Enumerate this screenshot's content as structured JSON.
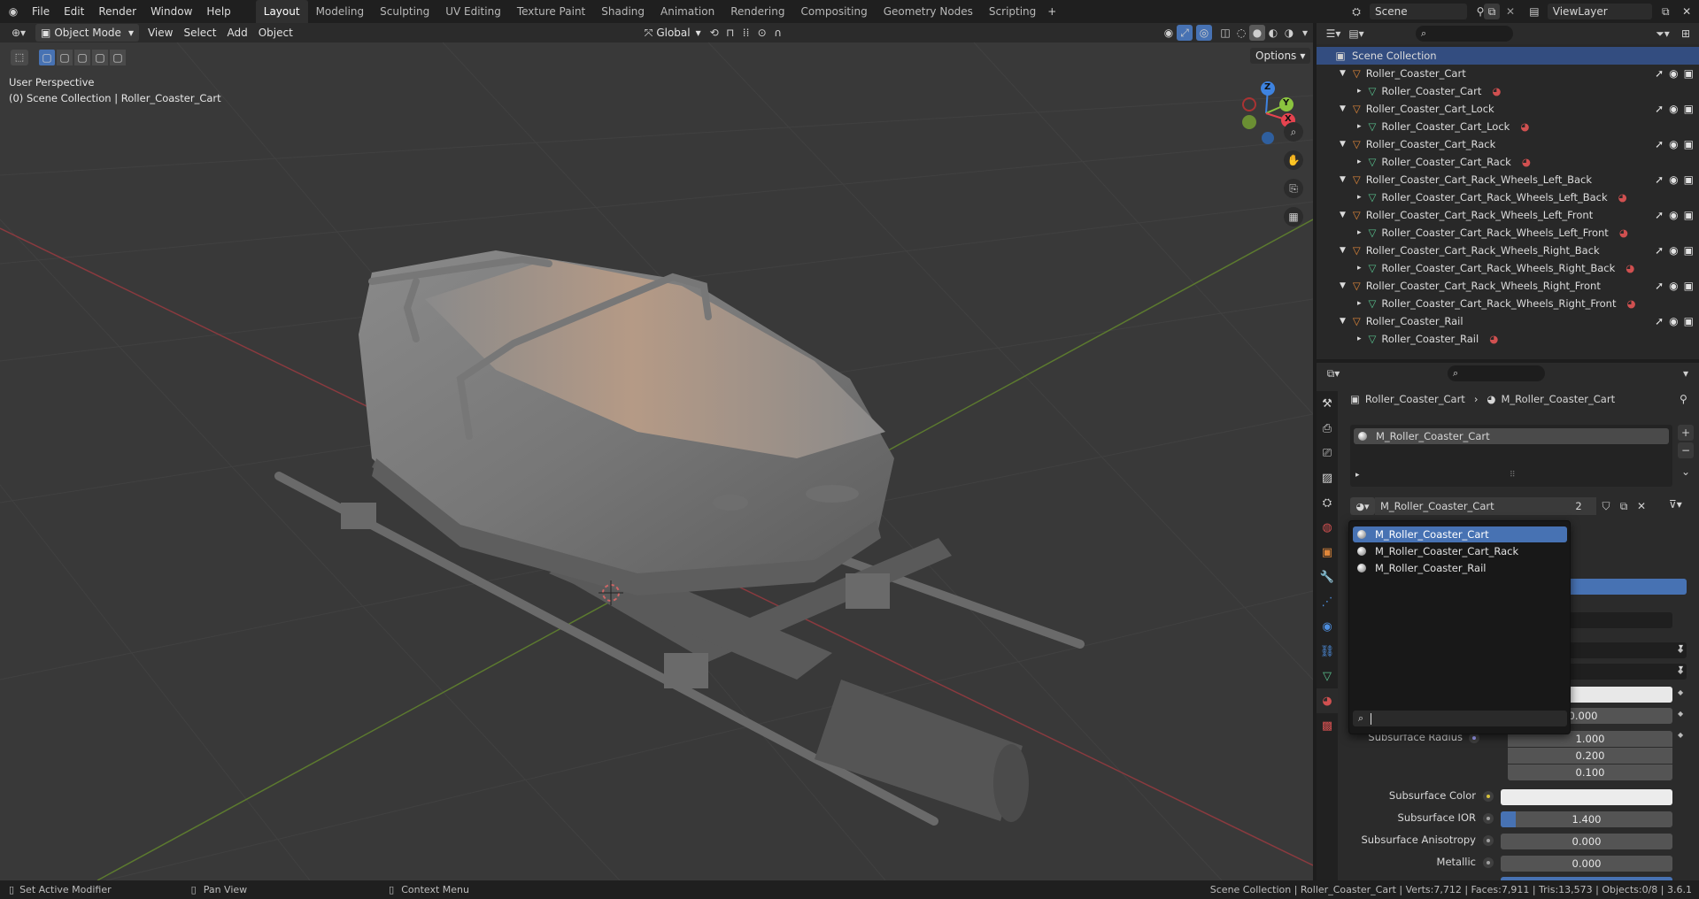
{
  "topmenu": [
    "File",
    "Edit",
    "Render",
    "Window",
    "Help"
  ],
  "workspaces": [
    "Layout",
    "Modeling",
    "Sculpting",
    "UV Editing",
    "Texture Paint",
    "Shading",
    "Animation",
    "Rendering",
    "Compositing",
    "Geometry Nodes",
    "Scripting"
  ],
  "active_workspace": "Layout",
  "scene_name": "Scene",
  "viewlayer_name": "ViewLayer",
  "viewport_header": {
    "mode": "Object Mode",
    "menus": [
      "View",
      "Select",
      "Add",
      "Object"
    ],
    "orientation": "Global",
    "options": "Options"
  },
  "viewport_overlay": {
    "view_name": "User Perspective",
    "context": "(0) Scene Collection | Roller_Coaster_Cart"
  },
  "gizmo": {
    "z": "Z",
    "y": "Y",
    "x": "X"
  },
  "outliner": {
    "root": "Scene Collection",
    "rows": [
      {
        "name": "Roller_Coaster_Cart",
        "mesh": "Roller_Coaster_Cart"
      },
      {
        "name": "Roller_Coaster_Cart_Lock",
        "mesh": "Roller_Coaster_Cart_Lock"
      },
      {
        "name": "Roller_Coaster_Cart_Rack",
        "mesh": "Roller_Coaster_Cart_Rack"
      },
      {
        "name": "Roller_Coaster_Cart_Rack_Wheels_Left_Back",
        "mesh": "Roller_Coaster_Cart_Rack_Wheels_Left_Back"
      },
      {
        "name": "Roller_Coaster_Cart_Rack_Wheels_Left_Front",
        "mesh": "Roller_Coaster_Cart_Rack_Wheels_Left_Front"
      },
      {
        "name": "Roller_Coaster_Cart_Rack_Wheels_Right_Back",
        "mesh": "Roller_Coaster_Cart_Rack_Wheels_Right_Back"
      },
      {
        "name": "Roller_Coaster_Cart_Rack_Wheels_Right_Front",
        "mesh": "Roller_Coaster_Cart_Rack_Wheels_Right_Front"
      },
      {
        "name": "Roller_Coaster_Rail",
        "mesh": "Roller_Coaster_Rail"
      }
    ]
  },
  "properties": {
    "breadcrumb_object": "Roller_Coaster_Cart",
    "breadcrumb_material": "M_Roller_Coaster_Cart",
    "slot": "M_Roller_Coaster_Cart",
    "material_name": "M_Roller_Coaster_Cart",
    "user_count": "2",
    "dropdown_items": [
      "M_Roller_Coaster_Cart",
      "M_Roller_Coaster_Cart_Rack",
      "M_Roller_Coaster_Rail"
    ],
    "partial_value": "0.000",
    "subsurface_radius_label": "Subsurface Radius",
    "subsurface_radius": [
      "1.000",
      "0.200",
      "0.100"
    ],
    "subsurface_color_label": "Subsurface Color",
    "subsurface_ior_label": "Subsurface IOR",
    "subsurface_ior": "1.400",
    "subsurface_ior_fill": 0.09,
    "subsurface_anisotropy_label": "Subsurface Anisotropy",
    "subsurface_anisotropy": "0.000",
    "metallic_label": "Metallic",
    "metallic": "0.000"
  },
  "statusbar": {
    "left1": "Set Active Modifier",
    "left2": "Pan View",
    "left3": "Context Menu",
    "right": "Scene Collection | Roller_Coaster_Cart | Verts:7,712 | Faces:7,911 | Tris:13,573 | Objects:0/8 | 3.6.1"
  },
  "colors": {
    "accent": "#4772b3",
    "object_orange": "#e0873a",
    "mesh_green": "#58c08d",
    "axis_x": "#e6434f",
    "axis_y": "#8bc43f",
    "axis_z": "#3e83e0"
  }
}
